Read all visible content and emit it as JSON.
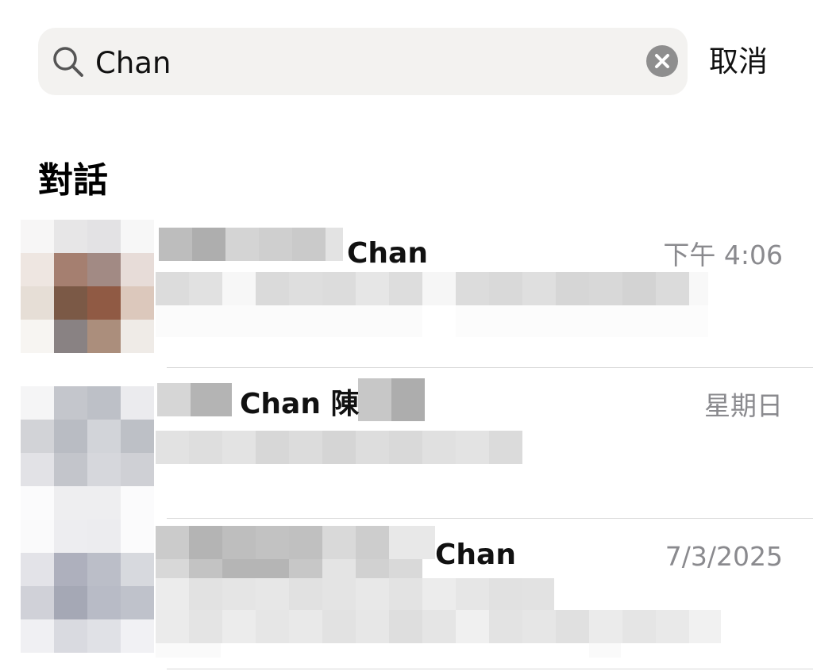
{
  "search": {
    "value": "Chan",
    "cancel_label": "取消"
  },
  "section": {
    "title": "對話"
  },
  "conversations": [
    {
      "name_visible": "Chan",
      "time": "下午 4:06"
    },
    {
      "name_visible": "Chan 陳",
      "time": "星期日"
    },
    {
      "name_visible": "Chan",
      "time": "7/3/2025"
    }
  ],
  "colors": {
    "search_bg": "#f3f2f0",
    "clear_icon_bg": "#8e8e8e",
    "secondary_text": "#8a8a8e",
    "divider": "#d8d8d8"
  },
  "icons": [
    "search-icon",
    "clear-icon"
  ]
}
